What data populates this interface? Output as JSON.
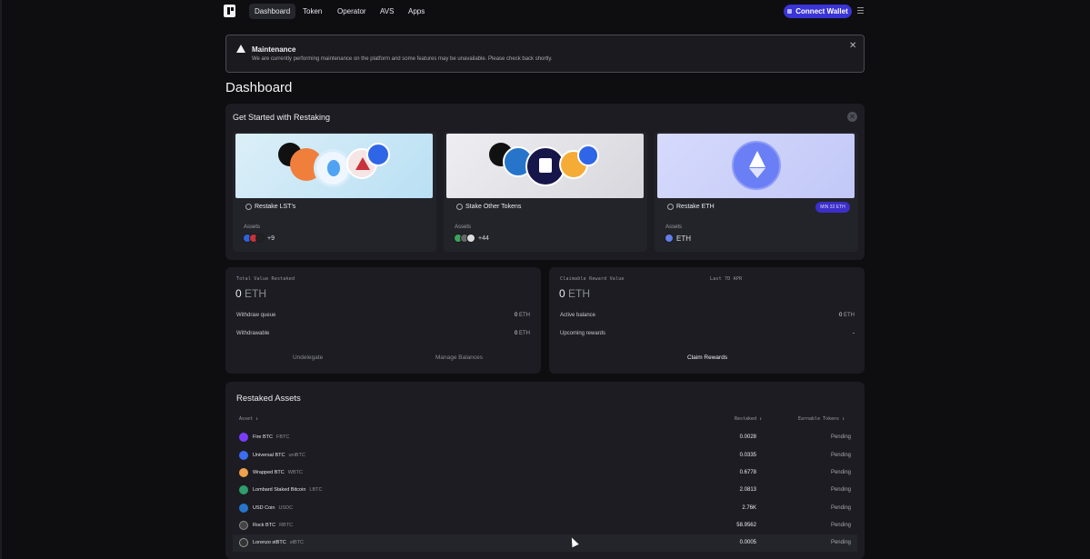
{
  "nav": {
    "links": [
      "Dashboard",
      "Token",
      "Operator",
      "AVS",
      "Apps"
    ],
    "connect_label": "Connect Wallet"
  },
  "banner": {
    "title": "Maintenance",
    "text": "We are currently performing maintenance on the platform and some features may be unavailable. Please check back shortly."
  },
  "page_title": "Dashboard",
  "get_started": {
    "title": "Get Started with Restaking",
    "cards": [
      {
        "name": "Restake LST's",
        "assets_label": "Assets",
        "assets_extra": "+9"
      },
      {
        "name": "Stake Other Tokens",
        "assets_label": "Assets",
        "assets_extra": "+44"
      },
      {
        "name": "Restake ETH",
        "assets_label": "Assets",
        "asset": "ETH",
        "badge": "MIN 32 ETH"
      }
    ]
  },
  "stats_left": {
    "label": "Total Value Restaked",
    "value": "0",
    "unit": "ETH",
    "rows": [
      {
        "label": "Withdraw queue",
        "value": "0",
        "unit": "ETH"
      },
      {
        "label": "Withdrawable",
        "value": "0",
        "unit": "ETH"
      }
    ],
    "action_1": "Undelegate",
    "action_2": "Manage Balances"
  },
  "stats_right": {
    "label": "Claimable Reward Value",
    "label_apr": "Last 7D APR",
    "value": "0",
    "unit": "ETH",
    "rows": [
      {
        "label": "Active balance",
        "value": "0",
        "unit": "ETH"
      },
      {
        "label": "Upcoming rewards",
        "value": "-"
      }
    ],
    "action": "Claim Rewards"
  },
  "restaked": {
    "title": "Restaked Assets",
    "columns": [
      "Asset ↕",
      "Restaked ↕",
      "Earnable Tokens ↕"
    ],
    "rows": [
      {
        "name": "Fire BTC",
        "symbol": "FBTC",
        "restaked": "0.0028",
        "earn": "Pending",
        "color": "#7b3cff"
      },
      {
        "name": "Universal BTC",
        "symbol": "uniBTC",
        "restaked": "0.0335",
        "earn": "Pending",
        "color": "#3a6df0"
      },
      {
        "name": "Wrapped BTC",
        "symbol": "WBTC",
        "restaked": "0.6778",
        "earn": "Pending",
        "color": "#f0a04b"
      },
      {
        "name": "Lombard Staked Bitcoin",
        "symbol": "LBTC",
        "restaked": "2.0813",
        "earn": "Pending",
        "color": "#2f9e6b"
      },
      {
        "name": "USD Coin",
        "symbol": "USDC",
        "restaked": "2.76K",
        "earn": "Pending",
        "color": "#2775ca"
      },
      {
        "name": "Rock BTC",
        "symbol": "RBTC",
        "restaked": "58.9562",
        "earn": "Pending",
        "color": "#444"
      },
      {
        "name": "Lorenzo stBTC",
        "symbol": "stBTC",
        "restaked": "0.0005",
        "earn": "Pending",
        "color": "#333"
      }
    ]
  }
}
